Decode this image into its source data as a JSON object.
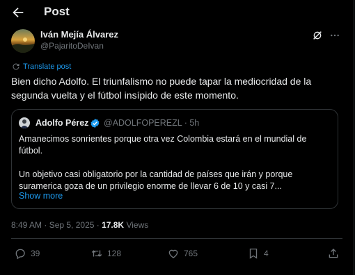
{
  "header": {
    "title": "Post"
  },
  "post": {
    "author_name": "Iván Mejía Álvarez",
    "author_handle": "@PajaritoDeIvan",
    "translate_label": "Translate post",
    "text": "Bien dicho Adolfo. El triunfalismo no puede tapar la mediocridad de la segunda vuelta y el fútbol insípido de este momento.",
    "timestamp": "8:49 AM · Sep 5, 2025 · ",
    "views_count": "17.8K",
    "views_label": " Views"
  },
  "quote": {
    "author_name": "Adolfo Pérez",
    "author_handle": "@ADOLFOPEREZL · 5h",
    "paragraph1": "Amanecimos sonrientes porque otra vez Colombia estará en el mundial de fútbol.",
    "paragraph2": "Un objetivo casi obligatorio por la cantidad de países que irán y porque suramerica goza de un privilegio enorme de llevar 6 de 10 y casi 7...",
    "show_more": "Show more"
  },
  "actions": {
    "replies": "39",
    "reposts": "128",
    "likes": "765",
    "bookmarks": "4"
  },
  "colors": {
    "background": "#000000",
    "text": "#e7e9ea",
    "muted": "#71767b",
    "accent": "#1d9bf0",
    "border": "#2f3336"
  },
  "icons": [
    "back-arrow-icon",
    "grok-icon",
    "more-icon",
    "translate-icon",
    "verified-icon",
    "reply-icon",
    "repost-icon",
    "like-icon",
    "bookmark-icon",
    "share-icon"
  ]
}
